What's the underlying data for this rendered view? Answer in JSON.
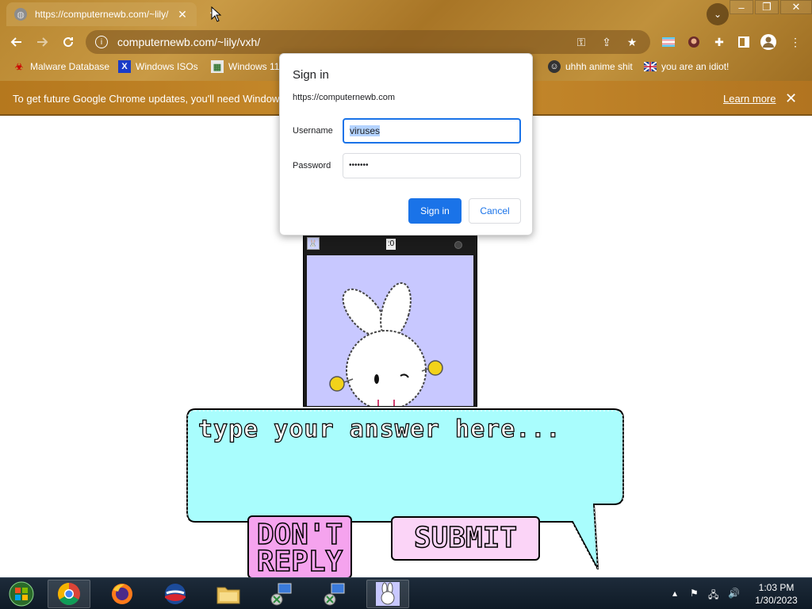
{
  "browser": {
    "tab": {
      "title": "https://computernewb.com/~lily/",
      "close": "✕"
    },
    "new_tab": "+",
    "window_controls": {
      "minimize": "–",
      "restore": "❐",
      "close": "✕"
    },
    "tab_search": "⌄",
    "address": "computernewb.com/~lily/vxh/",
    "bookmarks": [
      {
        "label": "Malware Database",
        "icon": "malware-icon"
      },
      {
        "label": "Windows ISOs",
        "icon": "x-icon"
      },
      {
        "label": "Windows 11",
        "icon": "image-icon"
      },
      {
        "label": "uhhh anime shit",
        "icon": "anime-icon"
      },
      {
        "label": "you are an idiot!",
        "icon": "flag-icon"
      }
    ]
  },
  "infobar": {
    "message": "To get future Google Chrome updates, you'll need Windows 1",
    "learn_more": "Learn more",
    "close": "✕"
  },
  "dialog": {
    "title": "Sign in",
    "origin": "https://computernewb.com",
    "username_label": "Username",
    "username_value": "viruses",
    "password_label": "Password",
    "password_value": "•••••••",
    "signin_label": "Sign in",
    "cancel_label": "Cancel"
  },
  "game_window": {
    "counter": ":0"
  },
  "page": {
    "answer_placeholder": "type your answer here...",
    "dont_reply": "DON'T REPLY",
    "submit": "SUBMIT"
  },
  "taskbar": {
    "apps": [
      "start",
      "chrome",
      "firefox",
      "obama",
      "file-explorer",
      "network-1",
      "network-2",
      "bunny"
    ],
    "time": "1:03 PM",
    "date": "1/30/2023"
  },
  "colors": {
    "accent": "#1a73e8",
    "bubble": "#a9fdfd",
    "dont_reply_bg": "#f5a3ee",
    "submit_bg": "#fbd4f7",
    "game_bg": "#c8c8ff"
  }
}
